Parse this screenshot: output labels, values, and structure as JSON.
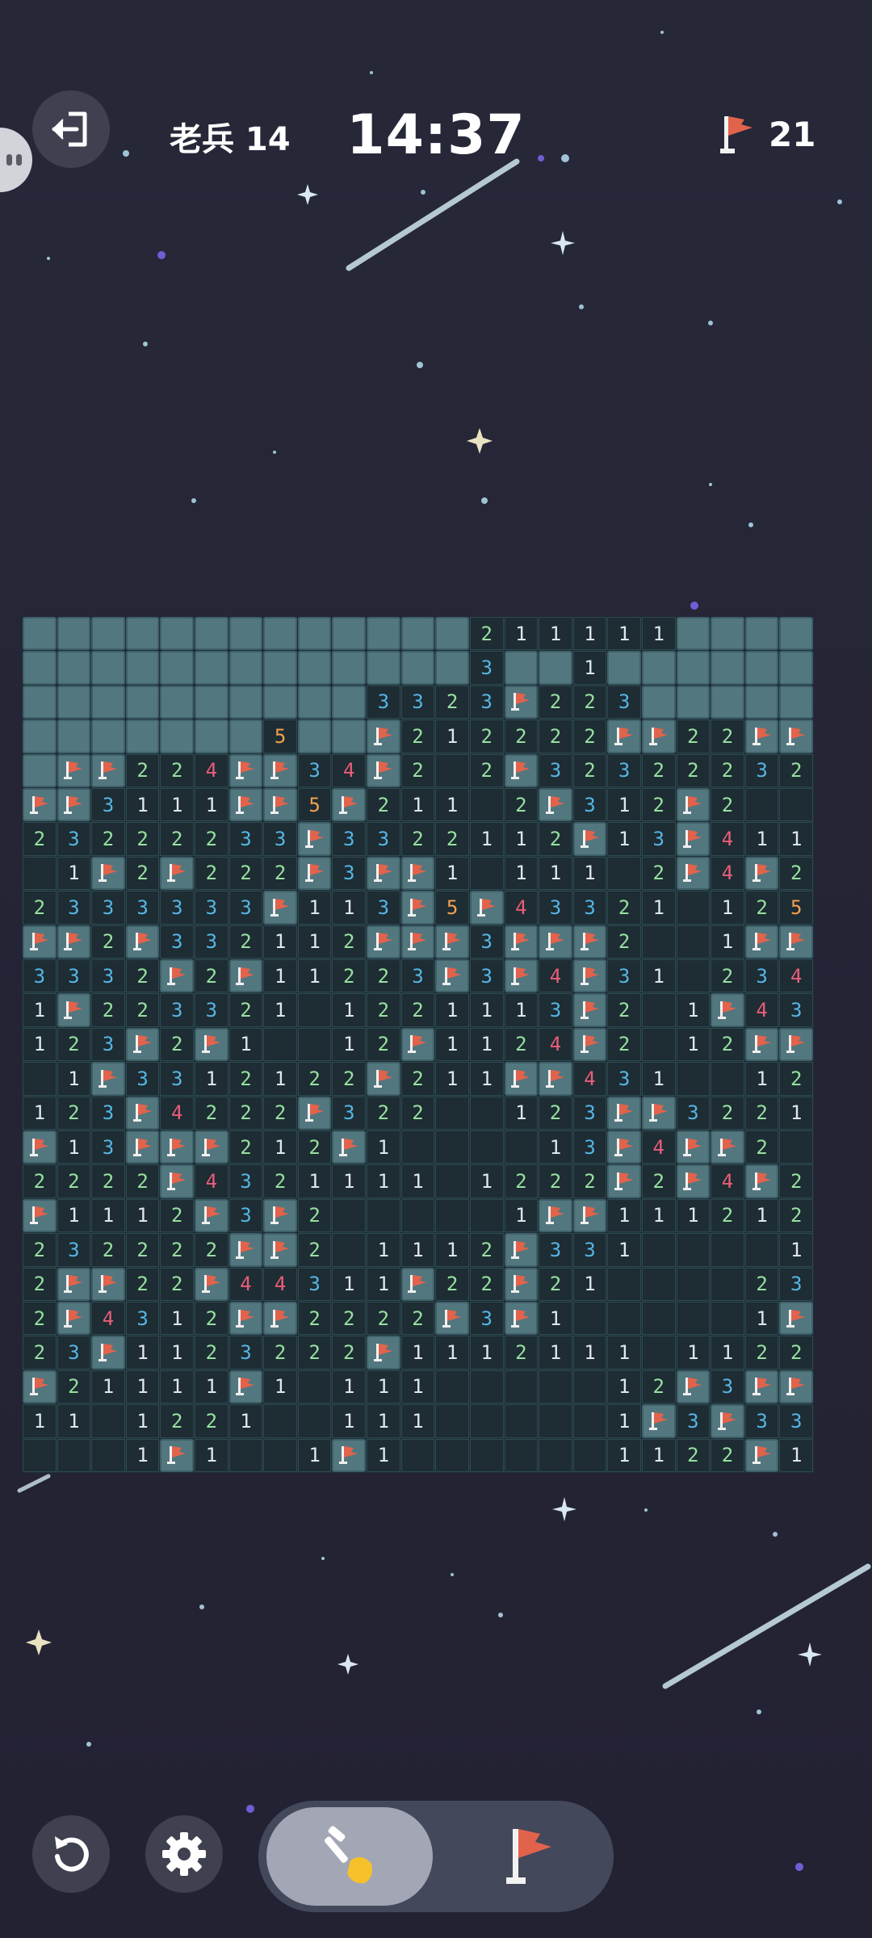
{
  "header": {
    "level_label": "老兵 14",
    "timer": "14:37",
    "flags_remaining": "21"
  },
  "icons": {
    "exit": "exit-icon",
    "restart": "restart-icon",
    "settings": "gear-icon",
    "dig": "shovel-icon",
    "flag": "flag-icon"
  },
  "colors": {
    "background": "#252536",
    "covered_cell": "#53777f",
    "open_cell": "#1e2c33",
    "flag": "#e2634c",
    "n1": "#dfe7ea",
    "n2": "#96e0a0",
    "n3": "#55b6e6",
    "n4": "#ea5d79",
    "n5": "#f2a14e"
  },
  "toolbar": {
    "active_tool": "dig"
  },
  "board": {
    "cols": 23,
    "rows": 25,
    "legend": "# = covered, F = flag, . = empty open, digits = adjacent mines",
    "cells": [
      "#############211111#####",
      "#############3##1#######",
      "##########3323F223######",
      "#######5##F212222FF22FFF",
      "#FF224FF34F2.2F3232223 2",
      "FF3111FF5F211.2F312F2...",
      "23222233F3322112F13F411.",
      ".1F2F222F3FF1.111.2F4F2.",
      "2333333F113F5F4332 1.12 5F3",
      "FF2F332112FFF3FFF2..1FFF31",
      "3332F2F11223F3F4F31.234F1",
      "1F22332 1.1221113F2.1F432",
      "123F2F1..12F1124F2.12FF1",
      ".1F3312122F211FF4 31..1221",
      "123F4222F322..123FF3221..",
      "F13FFF212F1....13F4FF2..",
      "2222F4321111.1222F2F4F2..",
      "F1112F3F2.....1FF1112121 1",
      "232222FF2.1112F331....1F2",
      "2FF22F44311F22F21....23F",
      "2F4312FF2222F3F1.....1F2",
      "23F1123222F1112111.1122232",
      "F21111F1.111.....12F3FF2F",
      "11.1221..111.....1F3F331",
      "...1F1..1F1......1122F1."
    ]
  }
}
